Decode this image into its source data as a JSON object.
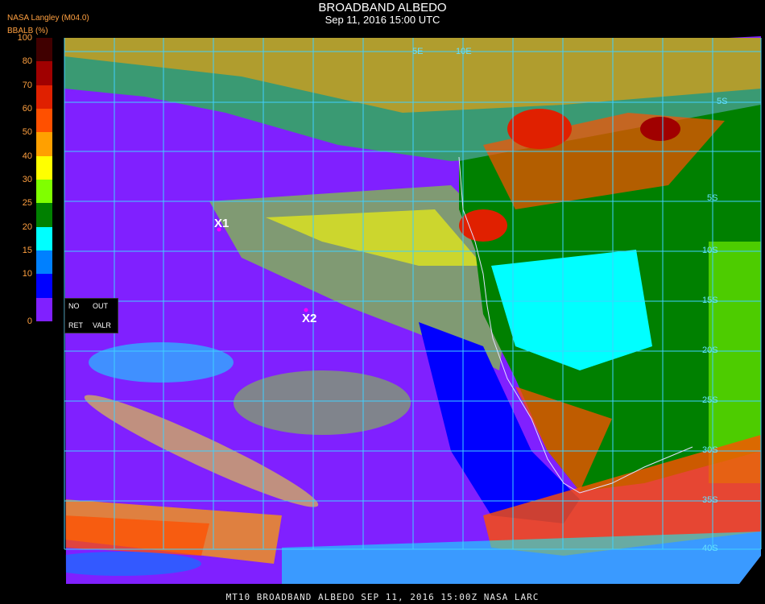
{
  "header": {
    "title": "BROADBAND ALBEDO",
    "datetime": "Sep 11, 2016 15:00 UTC",
    "provider": "NASA Langley (M04.0)",
    "units": "BBALB (%)"
  },
  "color_scale": {
    "ticks": [
      "100",
      "80",
      "70",
      "60",
      "50",
      "40",
      "30",
      "25",
      "20",
      "15",
      "10",
      "0"
    ],
    "colors": [
      "#400000",
      "#a00000",
      "#e02000",
      "#ff5000",
      "#ffa000",
      "#ffff00",
      "#80ff00",
      "#008000",
      "#00ffff",
      "#0080ff",
      "#0000ff",
      "#8020ff"
    ]
  },
  "legend": {
    "no": "NO",
    "out": "OUT",
    "ret": "RET",
    "valr": "VALR"
  },
  "markers": {
    "x1": "X1",
    "x2": "X2"
  },
  "lat_labels": [
    "5S",
    "5S",
    "10S",
    "15S",
    "20S",
    "25S",
    "30S",
    "35S",
    "40S"
  ],
  "lon_labels": [
    "5E",
    "10E"
  ],
  "footer": "MT10  BROADBAND ALBEDO   SEP 11, 2016 15:00Z   NASA LARC",
  "colors": {
    "grid": "#40d0ff",
    "ocean_clear": "#8020ff",
    "land_dark": "#008000",
    "desert": "#00ffff"
  }
}
